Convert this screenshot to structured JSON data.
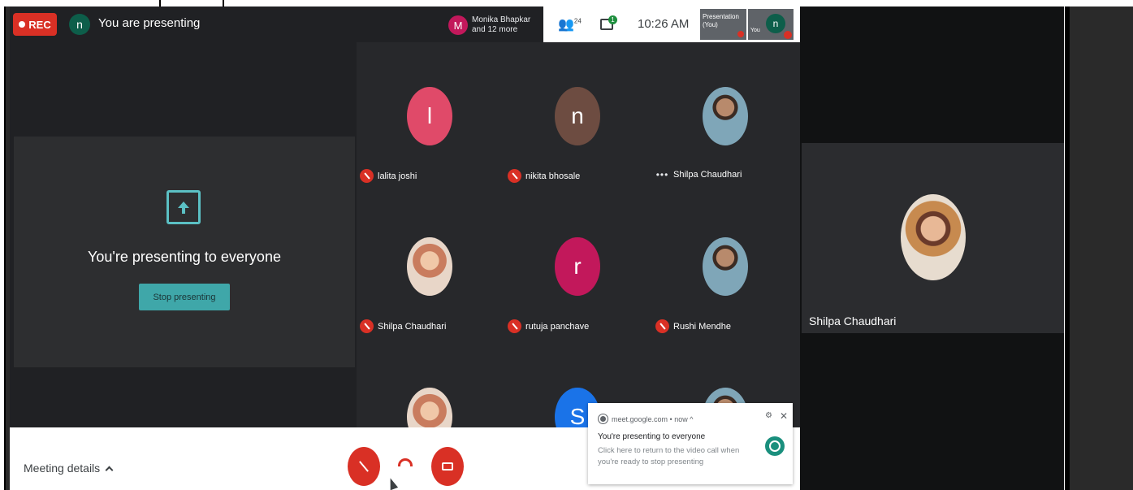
{
  "top_bar": {
    "rec_label": "REC",
    "self_initial": "n",
    "presenting_status": "You are presenting",
    "others_initial": "M",
    "others_line1": "Monika Bhapkar",
    "others_line2": "and 12 more"
  },
  "toolbar": {
    "people_count": "24",
    "chat_badge": "1",
    "time": "10:26 AM",
    "presentation_tile_label": "Presentation (You)",
    "you_tile_label": "You",
    "you_initial": "n"
  },
  "present_panel": {
    "title": "You're presenting to everyone",
    "stop_button": "Stop presenting"
  },
  "participants": [
    {
      "name": "lalita joshi",
      "initial": "l",
      "color": "#e04a69",
      "muted": true
    },
    {
      "name": "nikita bhosale",
      "initial": "n",
      "color": "#6d4c41",
      "muted": true
    },
    {
      "name": "Shilpa Chaudhari",
      "initial": "",
      "color": "",
      "muted": false
    },
    {
      "name": "Shilpa Chaudhari",
      "initial": "",
      "color": "",
      "muted": true
    },
    {
      "name": "rutuja panchave",
      "initial": "r",
      "color": "#c2185b",
      "muted": true
    },
    {
      "name": "Rushi Mendhe",
      "initial": "",
      "color": "",
      "muted": true
    },
    {
      "name": "",
      "initial": "",
      "color": "",
      "muted": false
    },
    {
      "name": "",
      "initial": "S",
      "color": "#1a73e8",
      "muted": false
    },
    {
      "name": "",
      "initial": "",
      "color": "",
      "muted": false
    }
  ],
  "bottom_bar": {
    "meeting_details": "Meeting details"
  },
  "notification": {
    "source": "meet.google.com • now ^",
    "title": "You're presenting to everyone",
    "body": "Click here to return to the video call when you're ready to stop presenting"
  },
  "side_tile": {
    "name": "Shilpa Chaudhari"
  }
}
